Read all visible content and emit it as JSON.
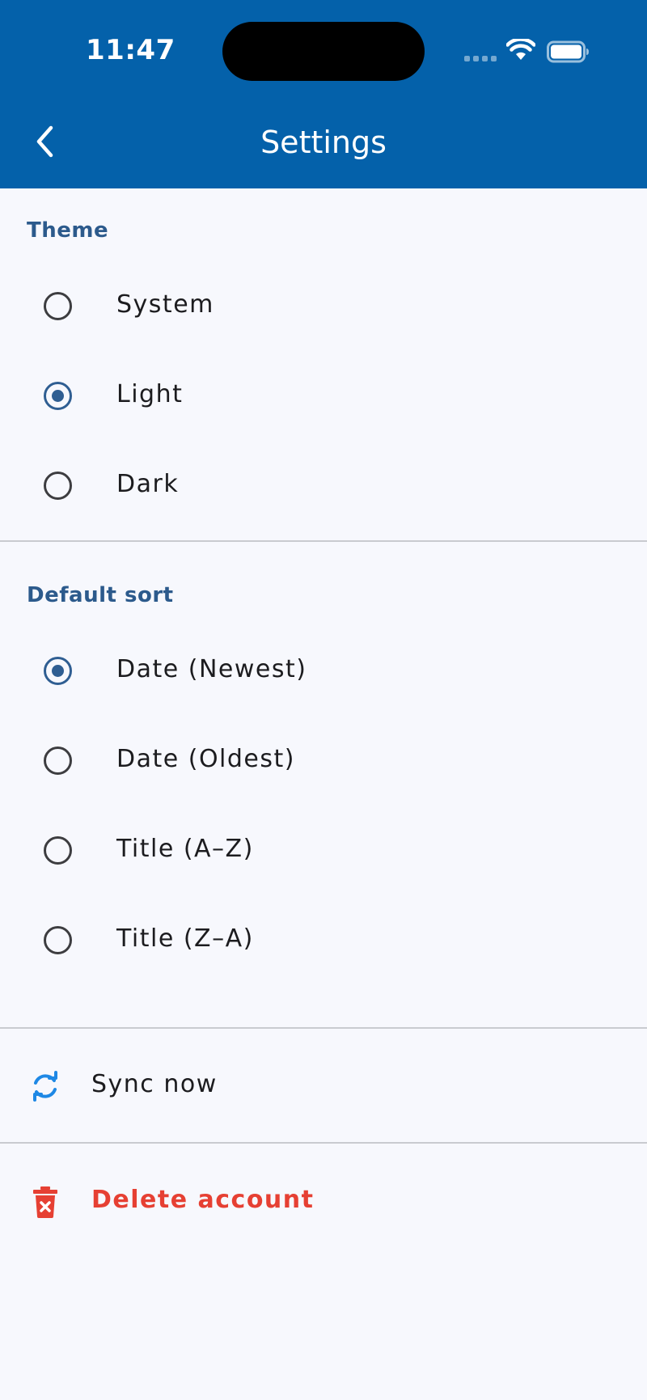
{
  "status_bar": {
    "time": "11:47",
    "icons": [
      "signal-icon",
      "wifi-icon",
      "battery-icon"
    ]
  },
  "app_bar": {
    "title": "Settings",
    "back_icon": "chevron-left-icon",
    "background_color": "#0461aa"
  },
  "theme_section": {
    "header": "Theme",
    "options": [
      {
        "label": "System",
        "selected": false
      },
      {
        "label": "Light",
        "selected": true
      },
      {
        "label": "Dark",
        "selected": false
      }
    ]
  },
  "sort_section": {
    "header": "Default sort",
    "options": [
      {
        "label": "Date (Newest)",
        "selected": true
      },
      {
        "label": "Date (Oldest)",
        "selected": false
      },
      {
        "label": "Title (A–Z)",
        "selected": false
      },
      {
        "label": "Title (Z–A)",
        "selected": false
      }
    ]
  },
  "actions": {
    "sync": {
      "label": "Sync now",
      "icon": "sync-icon",
      "color": "#1e88e5"
    },
    "delete": {
      "label": "Delete account",
      "icon": "trash-icon",
      "color": "#e64033"
    }
  },
  "colors": {
    "accent": "#2f5e92",
    "background": "#f7f8fd",
    "danger": "#e64033"
  }
}
